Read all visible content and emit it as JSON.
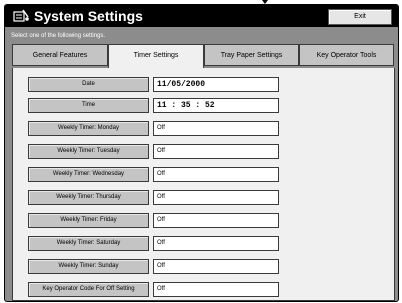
{
  "window": {
    "title": "System Settings",
    "exit_label": "Exit",
    "instruction": "Select one of the following settings."
  },
  "tabs": [
    {
      "label": "General Features",
      "active": false
    },
    {
      "label": "Timer Settings",
      "active": true
    },
    {
      "label": "Tray Paper Settings",
      "active": false
    },
    {
      "label": "Key Operator Tools",
      "active": false
    }
  ],
  "rows": [
    {
      "label": "Date",
      "value": "11/05/2000"
    },
    {
      "label": "Time",
      "value": "11 : 35 : 52"
    },
    {
      "label": "Weekly Timer: Monday",
      "value": "Off"
    },
    {
      "label": "Weekly Timer: Tuesday",
      "value": "Off"
    },
    {
      "label": "Weekly Timer: Wednesday",
      "value": "Off"
    },
    {
      "label": "Weekly Timer: Thursday",
      "value": "Off"
    },
    {
      "label": "Weekly Timer: Friday",
      "value": "Off"
    },
    {
      "label": "Weekly Timer: Saturday",
      "value": "Off"
    },
    {
      "label": "Weekly Timer: Sunday",
      "value": "Off"
    },
    {
      "label": "Key Operator Code For Off Setting",
      "value": "Off"
    }
  ]
}
